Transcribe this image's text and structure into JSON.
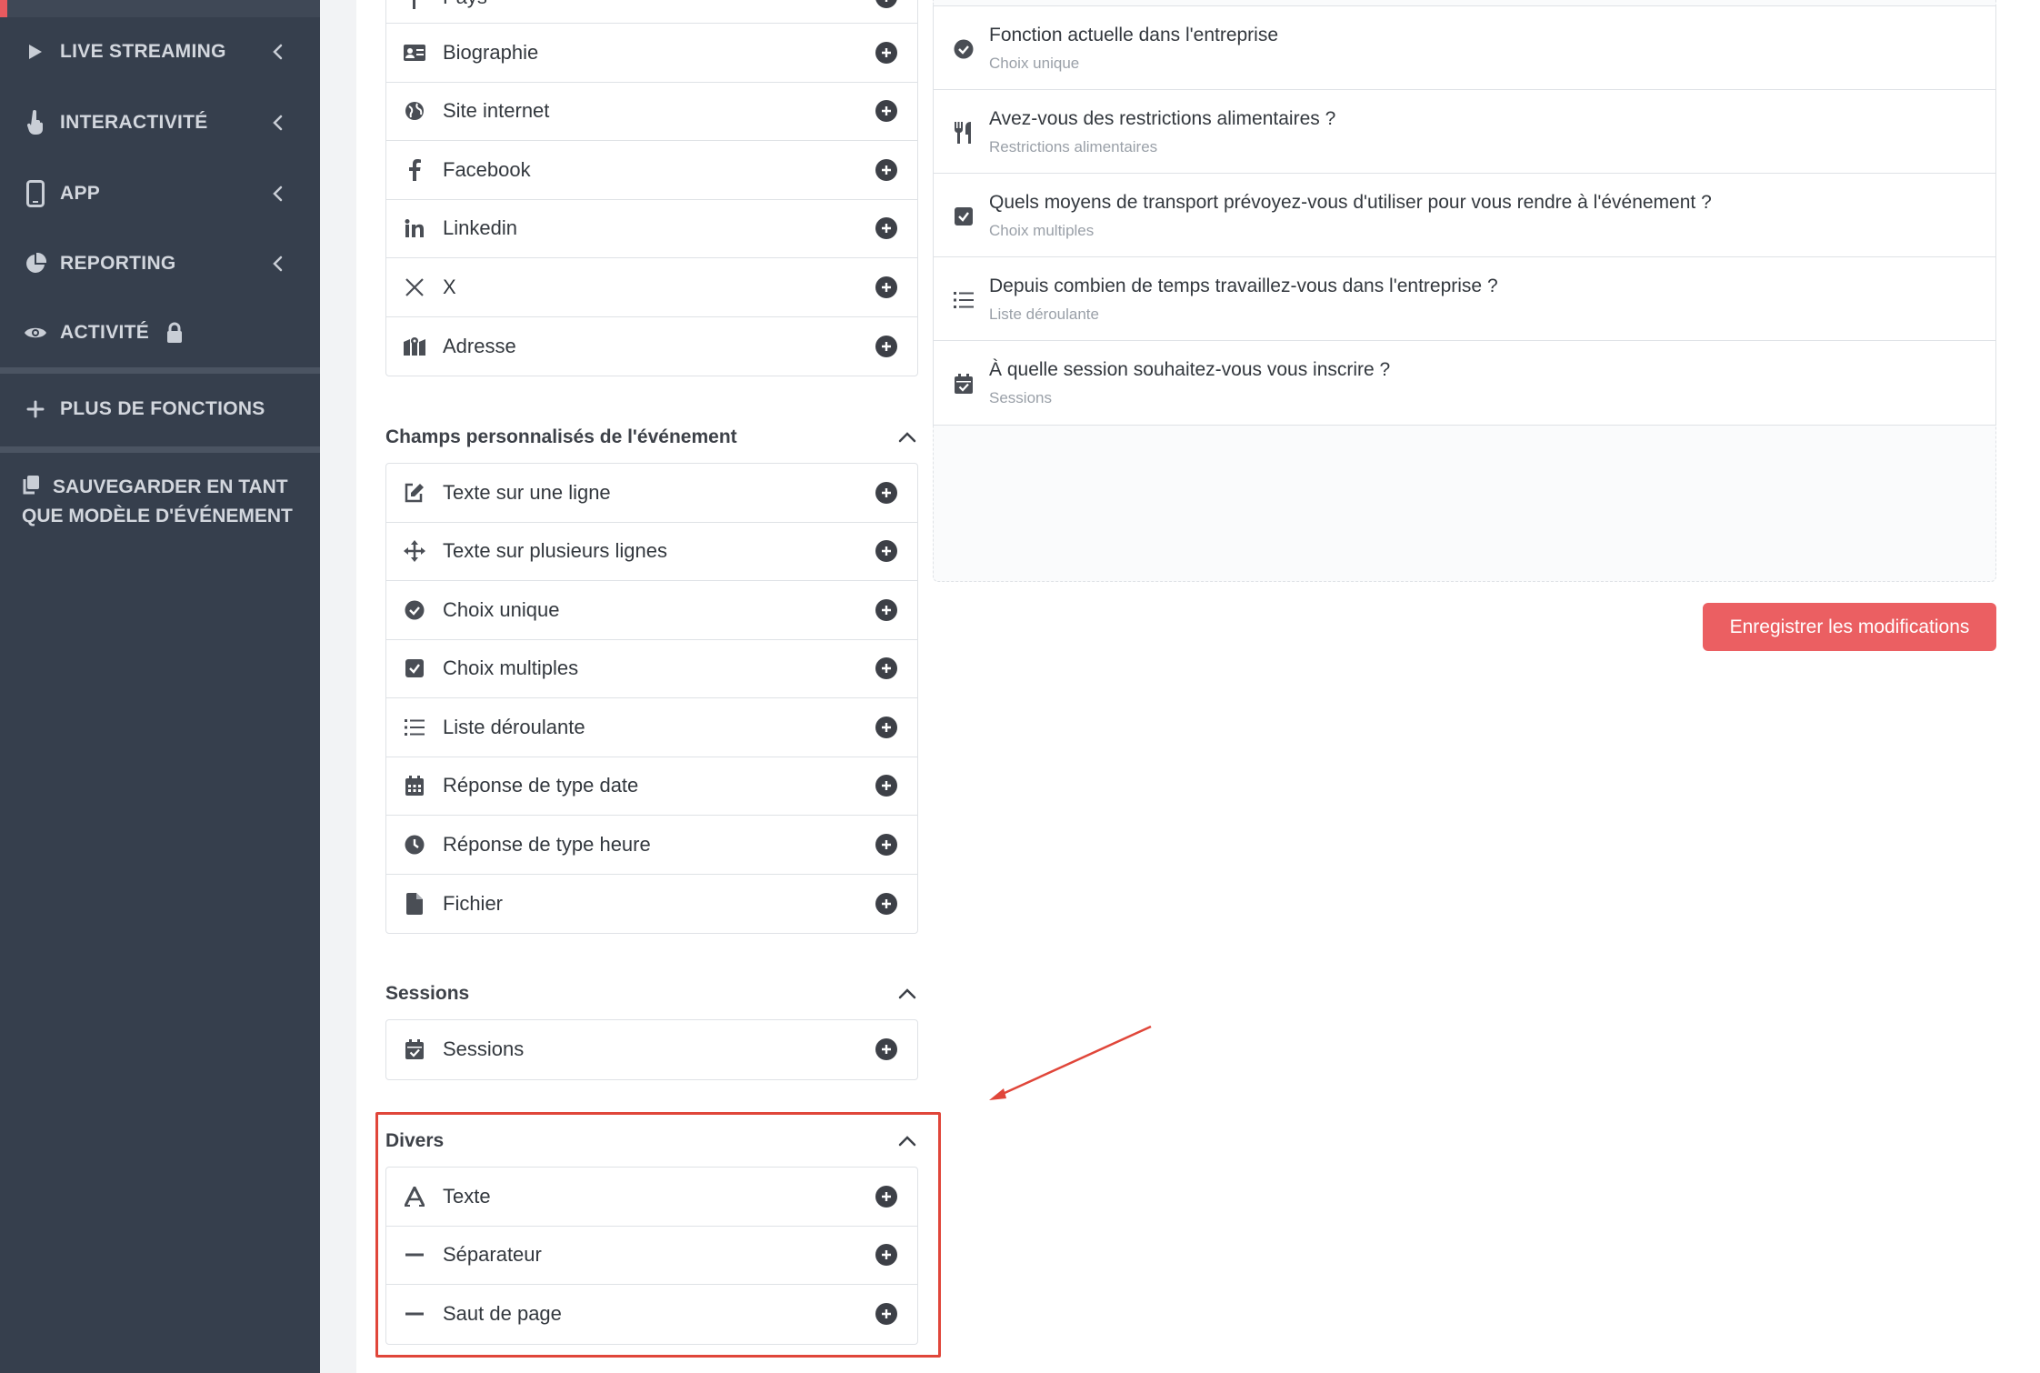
{
  "sidebar": {
    "items": [
      {
        "label": "LIVE STREAMING",
        "icon": "play-icon"
      },
      {
        "label": "INTERACTIVITÉ",
        "icon": "pointer-hand-icon"
      },
      {
        "label": "APP",
        "icon": "mobile-icon"
      },
      {
        "label": "REPORTING",
        "icon": "pie-chart-icon"
      },
      {
        "label": "ACTIVITÉ",
        "icon": "eye-icon",
        "locked": true
      }
    ],
    "more_label": "PLUS DE FONCTIONS",
    "save_template_label": "SAUVEGARDER EN TANT QUE MODÈLE D'ÉVÉNEMENT",
    "accent_color": "#e85a5f"
  },
  "profile_fields": {
    "items": [
      {
        "label": "Biographie",
        "icon": "id-card-icon"
      },
      {
        "label": "Site internet",
        "icon": "globe-icon"
      },
      {
        "label": "Facebook",
        "icon": "facebook-icon"
      },
      {
        "label": "Linkedin",
        "icon": "linkedin-icon"
      },
      {
        "label": "X",
        "icon": "x-icon"
      },
      {
        "label": "Adresse",
        "icon": "map-icon"
      }
    ]
  },
  "custom_fields": {
    "title": "Champs personnalisés de l'événement",
    "items": [
      {
        "label": "Texte sur une ligne",
        "icon": "edit-icon"
      },
      {
        "label": "Texte sur plusieurs lignes",
        "icon": "move-arrows-icon"
      },
      {
        "label": "Choix unique",
        "icon": "check-circle-icon"
      },
      {
        "label": "Choix multiples",
        "icon": "checkbox-icon"
      },
      {
        "label": "Liste déroulante",
        "icon": "list-icon"
      },
      {
        "label": "Réponse de type date",
        "icon": "calendar-icon"
      },
      {
        "label": "Réponse de type heure",
        "icon": "clock-icon"
      },
      {
        "label": "Fichier",
        "icon": "file-icon"
      }
    ]
  },
  "sessions_section": {
    "title": "Sessions",
    "items": [
      {
        "label": "Sessions",
        "icon": "calendar-check-icon"
      }
    ]
  },
  "misc_section": {
    "title": "Divers",
    "items": [
      {
        "label": "Texte",
        "icon": "font-icon"
      },
      {
        "label": "Séparateur",
        "icon": "minus-icon"
      },
      {
        "label": "Saut de page",
        "icon": "minus-icon"
      }
    ]
  },
  "form_preview": {
    "questions": [
      {
        "title": "Fonction actuelle dans l'entreprise",
        "type": "Choix unique",
        "icon": "check-circle-icon"
      },
      {
        "title": "Avez-vous des restrictions alimentaires ?",
        "type": "Restrictions alimentaires",
        "icon": "utensils-icon"
      },
      {
        "title": "Quels moyens de transport prévoyez-vous d'utiliser pour vous rendre à l'événement ?",
        "type": "Choix multiples",
        "icon": "checkbox-icon"
      },
      {
        "title": "Depuis combien de temps travaillez-vous dans l'entreprise ?",
        "type": "Liste déroulante",
        "icon": "list-icon"
      },
      {
        "title": "À quelle session souhaitez-vous vous inscrire ?",
        "type": "Sessions",
        "icon": "calendar-check-icon"
      }
    ]
  },
  "actions": {
    "save_label": "Enregistrer les modifications",
    "save_color": "#eb5f62"
  },
  "annotation": {
    "color": "#e0463a"
  }
}
